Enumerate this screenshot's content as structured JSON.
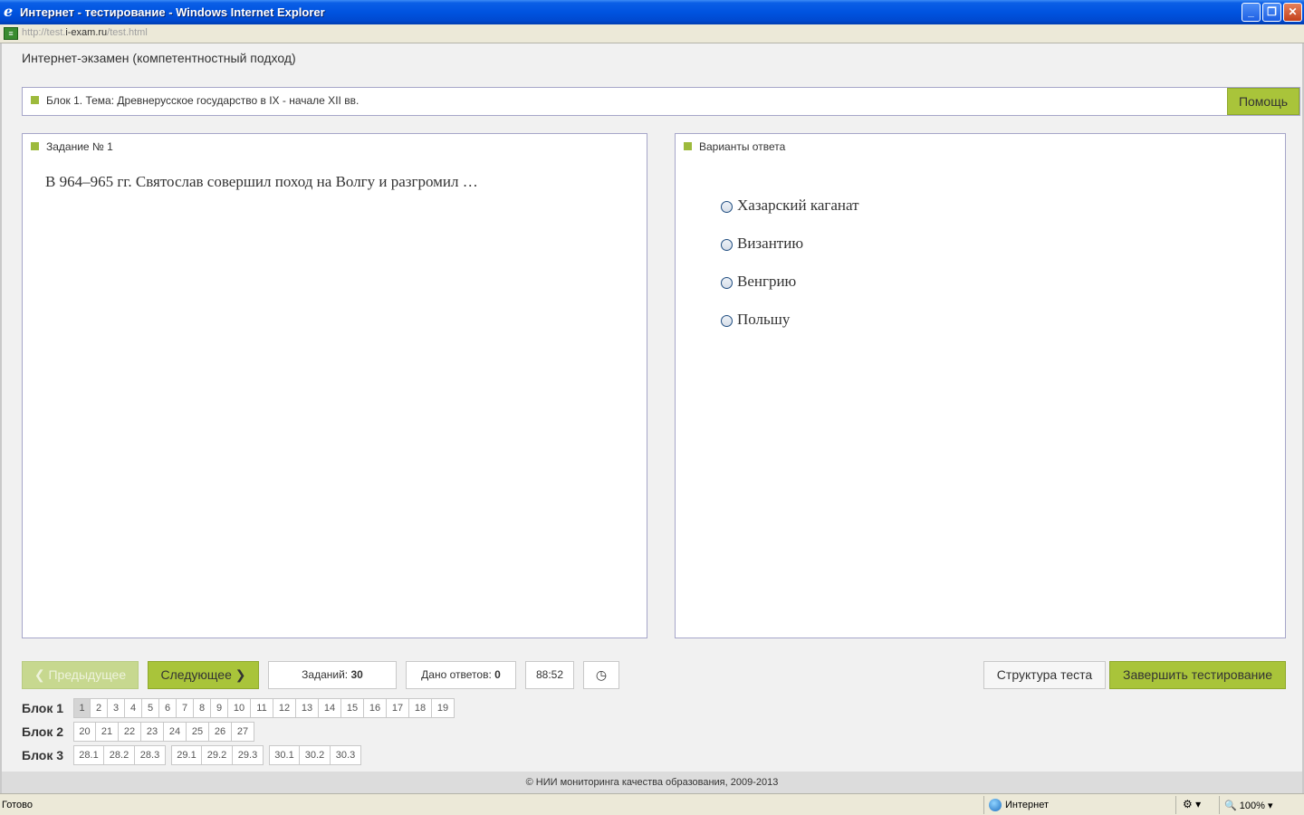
{
  "window": {
    "title": "Интернет - тестирование - Windows Internet Explorer",
    "url_prefix": "http://test.",
    "url_domain": "i-exam.ru",
    "url_path": "/test.html"
  },
  "app": {
    "title": "Интернет-экзамен (компетентностный подход)",
    "block_label": "Блок 1. Тема: Древнерусское государство в IX - начале XII вв.",
    "help_label": "Помощь"
  },
  "task": {
    "label": "Задание № 1",
    "question": "В 964–965 гг. Святослав совершил поход на Волгу и разгромил …"
  },
  "answers": {
    "label": "Варианты ответа",
    "options": [
      "Хазарский каганат",
      "Византию",
      "Венгрию",
      "Польшу"
    ]
  },
  "controls": {
    "prev_label": "Предыдущее",
    "next_label": "Следующее",
    "tasks_label": "Заданий:",
    "tasks_count": "30",
    "answered_label": "Дано ответов:",
    "answered_count": "0",
    "timer": "88:52",
    "structure_label": "Структура теста",
    "finish_label": "Завершить тестирование"
  },
  "navigation": {
    "block1_label": "Блок 1",
    "block1": [
      "1",
      "2",
      "3",
      "4",
      "5",
      "6",
      "7",
      "8",
      "9",
      "10",
      "11",
      "12",
      "13",
      "14",
      "15",
      "16",
      "17",
      "18",
      "19"
    ],
    "block2_label": "Блок 2",
    "block2": [
      "20",
      "21",
      "22",
      "23",
      "24",
      "25",
      "26",
      "27"
    ],
    "block3_label": "Блок 3",
    "block3_groups": [
      [
        "28.1",
        "28.2",
        "28.3"
      ],
      [
        "29.1",
        "29.2",
        "29.3"
      ],
      [
        "30.1",
        "30.2",
        "30.3"
      ]
    ]
  },
  "footer": {
    "text": "© НИИ мониторинга качества образования, 2009-2013"
  },
  "status": {
    "ready": "Готово",
    "zone": "Интернет",
    "zoom": "100%"
  },
  "colors": {
    "accent": "#a9c43a",
    "accent_light": "#c7d88f",
    "titlebar": "#0053e0"
  }
}
